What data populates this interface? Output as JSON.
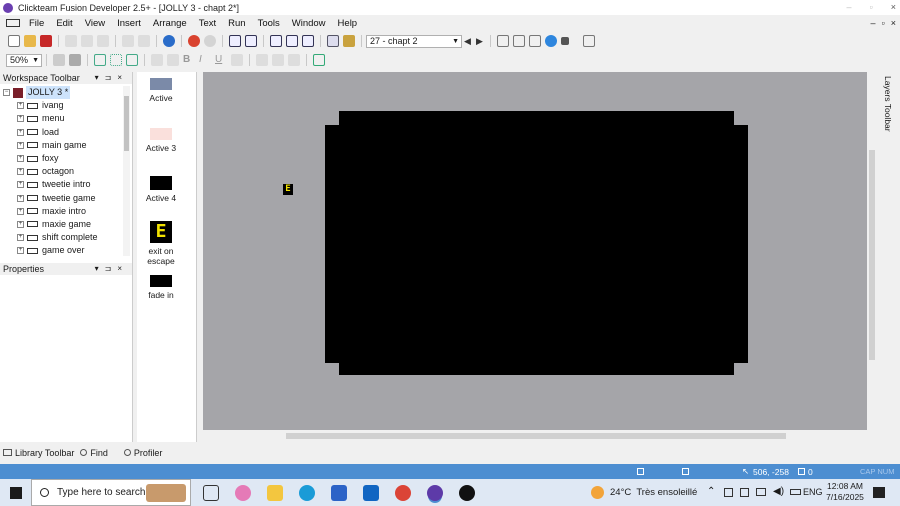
{
  "window": {
    "title": "Clickteam Fusion Developer 2.5+ - [JOLLY 3 - chapt 2*]",
    "controls": [
      "–",
      "▫",
      "×"
    ],
    "mdi_controls": [
      "–",
      "▫",
      "×"
    ]
  },
  "menu": [
    "File",
    "Edit",
    "View",
    "Insert",
    "Arrange",
    "Text",
    "Run",
    "Tools",
    "Window",
    "Help"
  ],
  "toolbar": {
    "frame_combo": "27 - chapt 2",
    "zoom_combo": "50%"
  },
  "workspace": {
    "title": "Workspace Toolbar",
    "root": "JOLLY 3 *",
    "frames": [
      "ivang",
      "menu",
      "load",
      "main game",
      "foxy",
      "octagon",
      "tweetie intro",
      "tweetie game",
      "maxie intro",
      "maxie game",
      "shift complete",
      "game over"
    ]
  },
  "properties": {
    "title": "Properties"
  },
  "objects": [
    {
      "label": "Active"
    },
    {
      "label": "Active 3"
    },
    {
      "label": "Active 4"
    },
    {
      "label": "exit on escape"
    },
    {
      "label": "fade in"
    }
  ],
  "editor": {
    "floating_object": "E"
  },
  "right_strip": {
    "label": "Layers Toolbar"
  },
  "bottom_tabs": [
    "Library Toolbar",
    "Find",
    "Profiler"
  ],
  "status": {
    "coords": "506, -258",
    "count": "0",
    "keys": "CAP  NUM"
  },
  "taskbar": {
    "search_placeholder": "Type here to search",
    "weather": "24°C  Très ensoleillé",
    "lang": "ENG",
    "time": "12:08 AM",
    "date": "7/16/2025"
  },
  "colors": {
    "editor_bg": "#a5a5a9",
    "frame": "#000000",
    "statusbar": "#4d8ed1",
    "taskbar": "#dfe8f4"
  }
}
